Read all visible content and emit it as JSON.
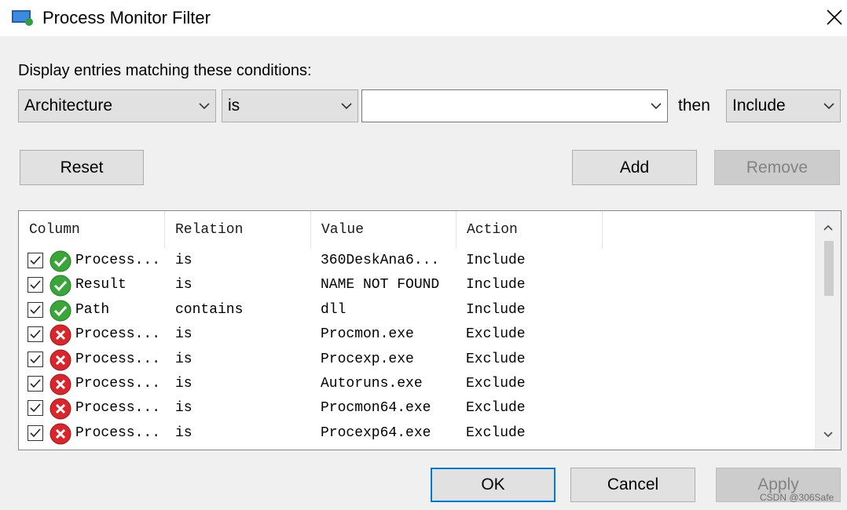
{
  "window": {
    "title": "Process Monitor Filter",
    "close_symbol": "✕"
  },
  "filter": {
    "prompt": "Display entries matching these conditions:",
    "column_value": "Architecture",
    "relation_value": "is",
    "value_value": "",
    "then_label": "then",
    "action_value": "Include"
  },
  "buttons": {
    "reset": "Reset",
    "add": "Add",
    "remove": "Remove",
    "ok": "OK",
    "cancel": "Cancel",
    "apply": "Apply"
  },
  "table": {
    "headers": [
      "Column",
      "Relation",
      "Value",
      "Action"
    ],
    "rows": [
      {
        "checked": true,
        "status": "include",
        "column": "Process...",
        "relation": "is",
        "value": "360DeskAna6...",
        "action": "Include"
      },
      {
        "checked": true,
        "status": "include",
        "column": "Result",
        "relation": "is",
        "value": "NAME NOT FOUND",
        "action": "Include"
      },
      {
        "checked": true,
        "status": "include",
        "column": "Path",
        "relation": "contains",
        "value": "dll",
        "action": "Include"
      },
      {
        "checked": true,
        "status": "exclude",
        "column": "Process...",
        "relation": "is",
        "value": "Procmon.exe",
        "action": "Exclude"
      },
      {
        "checked": true,
        "status": "exclude",
        "column": "Process...",
        "relation": "is",
        "value": "Procexp.exe",
        "action": "Exclude"
      },
      {
        "checked": true,
        "status": "exclude",
        "column": "Process...",
        "relation": "is",
        "value": "Autoruns.exe",
        "action": "Exclude"
      },
      {
        "checked": true,
        "status": "exclude",
        "column": "Process...",
        "relation": "is",
        "value": "Procmon64.exe",
        "action": "Exclude"
      },
      {
        "checked": true,
        "status": "exclude",
        "column": "Process...",
        "relation": "is",
        "value": "Procexp64.exe",
        "action": "Exclude"
      }
    ]
  },
  "watermark": "CSDN @306Safe",
  "colors": {
    "include_green": "#3aa63a",
    "exclude_red": "#d9262c",
    "default_button_border": "#0078d7"
  },
  "icons": {
    "app": "process-monitor-app-icon",
    "include": "green-check-circle-icon",
    "exclude": "red-x-circle-icon"
  }
}
